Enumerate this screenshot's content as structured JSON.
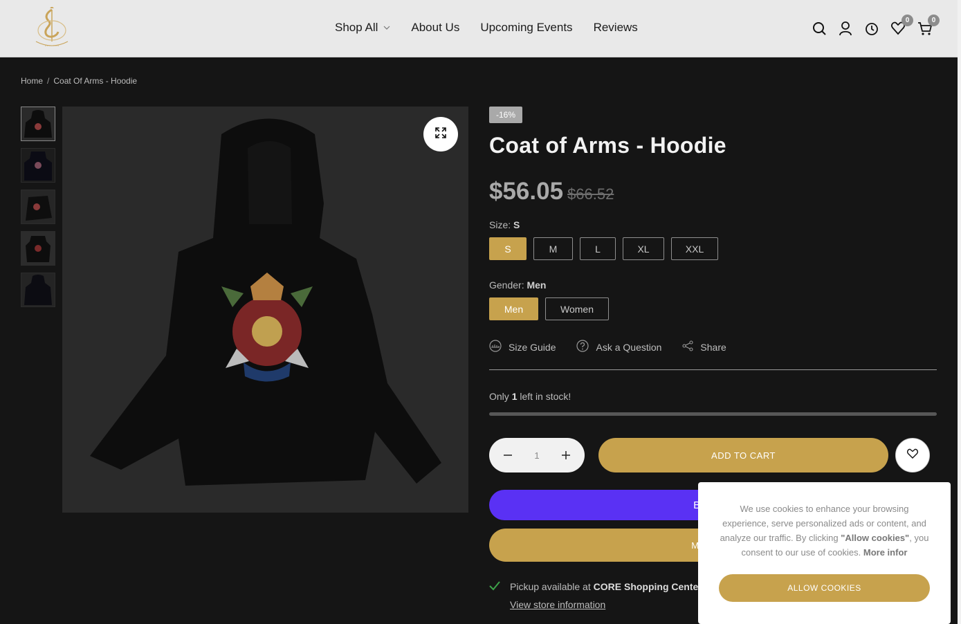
{
  "header": {
    "nav": [
      {
        "label": "Shop All",
        "has_dropdown": true
      },
      {
        "label": "About Us"
      },
      {
        "label": "Upcoming Events"
      },
      {
        "label": "Reviews"
      }
    ],
    "wishlist_count": "0",
    "cart_count": "0",
    "icons": [
      "search-icon",
      "account-icon",
      "recently-viewed-icon",
      "wishlist-icon",
      "cart-icon"
    ]
  },
  "breadcrumb": {
    "home": "Home",
    "separator": "/",
    "current": "Coat Of Arms - Hoodie"
  },
  "product": {
    "discount_badge": "-16%",
    "title": "Coat of Arms - Hoodie",
    "price": "$56.05",
    "compare_price": "$66.52",
    "size_label": "Size:",
    "size_selected": "S",
    "sizes": [
      "S",
      "M",
      "L",
      "XL",
      "XXL"
    ],
    "gender_label": "Gender:",
    "gender_selected": "Men",
    "genders": [
      "Men",
      "Women"
    ],
    "links": {
      "size_guide": "Size Guide",
      "ask": "Ask a Question",
      "share": "Share"
    },
    "stock_prefix": "Only",
    "stock_count": "1",
    "stock_suffix": "left in stock!",
    "quantity": "1",
    "add_to_cart": "ADD TO CART",
    "buy_with": "Buy with",
    "more_payment": "MORE PA",
    "pickup_prefix": "Pickup available at",
    "pickup_location": "CORE Shopping Center",
    "store_info": "View store information"
  },
  "cookie": {
    "text_1": "We use cookies to enhance your browsing experience, serve personalized ads or content, and analyze our traffic. By clicking",
    "highlight": "\"Allow cookies\"",
    "text_2": ", you consent to our use of cookies.",
    "more_info": "More infor",
    "allow_button": "ALLOW COOKIES"
  },
  "colors": {
    "accent": "#c7a24d",
    "shop_pay": "#5a31f4",
    "background": "#151515",
    "header": "#e9e9e9"
  }
}
